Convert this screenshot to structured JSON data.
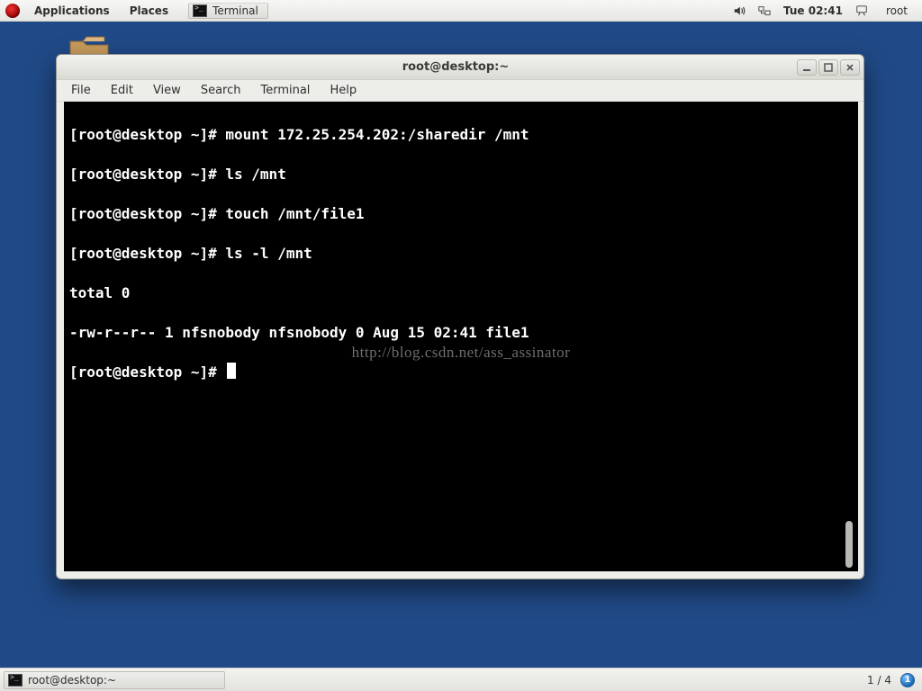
{
  "top_panel": {
    "applications": "Applications",
    "places": "Places",
    "task_terminal": "Terminal",
    "clock": "Tue 02:41",
    "user": "root"
  },
  "window": {
    "title": "root@desktop:~",
    "menus": {
      "file": "File",
      "edit": "Edit",
      "view": "View",
      "search": "Search",
      "terminal": "Terminal",
      "help": "Help"
    }
  },
  "terminal": {
    "prompt": "[root@desktop ~]# ",
    "lines": {
      "l1_cmd": "mount 172.25.254.202:/sharedir /mnt",
      "l2_cmd": "ls /mnt",
      "l3_cmd": "touch /mnt/file1",
      "l4_cmd": "ls -l /mnt",
      "l5_out": "total 0",
      "l6_out": "-rw-r--r-- 1 nfsnobody nfsnobody 0 Aug 15 02:41 file1"
    },
    "watermark": "http://blog.csdn.net/ass_assinator"
  },
  "bottom_panel": {
    "task_label": "root@desktop:~",
    "workspace": "1 / 4",
    "bubble": "1"
  }
}
